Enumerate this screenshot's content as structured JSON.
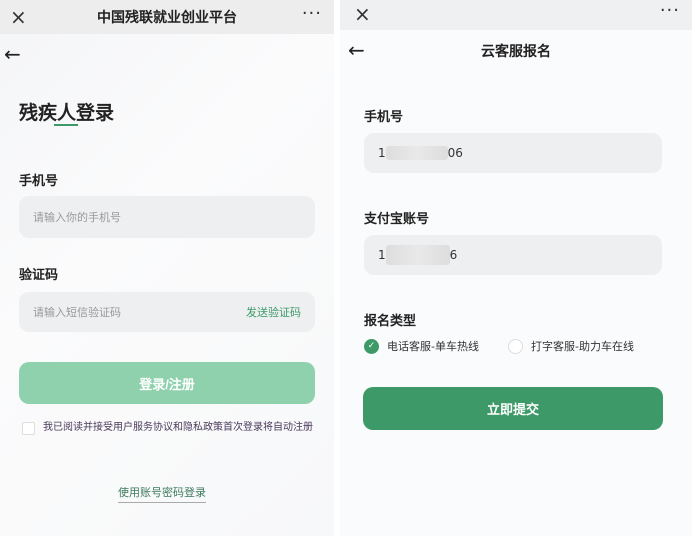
{
  "left": {
    "app_title": "中国残联就业创业平台",
    "close_icon": "×",
    "more_icon": "···",
    "back_icon": "←",
    "page_title": "残疾人登录",
    "phone_label": "手机号",
    "phone_placeholder": "请输入你的手机号",
    "code_label": "验证码",
    "code_placeholder": "请输入短信验证码",
    "send_code": "发送验证码",
    "login_button": "登录/注册",
    "agreement": "我已阅读并接受用户服务协议和隐私政策首次登录将自动注册",
    "password_login": "使用账号密码登录"
  },
  "right": {
    "close_icon": "×",
    "more_icon": "···",
    "back_icon": "←",
    "page_title": "云客服报名",
    "phone_label": "手机号",
    "phone_prefix": "1",
    "phone_suffix": "06",
    "alipay_label": "支付宝账号",
    "alipay_prefix": "1",
    "alipay_suffix": "6",
    "type_label": "报名类型",
    "options": [
      {
        "label": "电话客服-单车热线",
        "selected": true
      },
      {
        "label": "打字客服-助力车在线",
        "selected": false
      }
    ],
    "submit": "立即提交"
  },
  "colors": {
    "accent": "#3d9a68",
    "accent_light": "#8fd1ad"
  }
}
